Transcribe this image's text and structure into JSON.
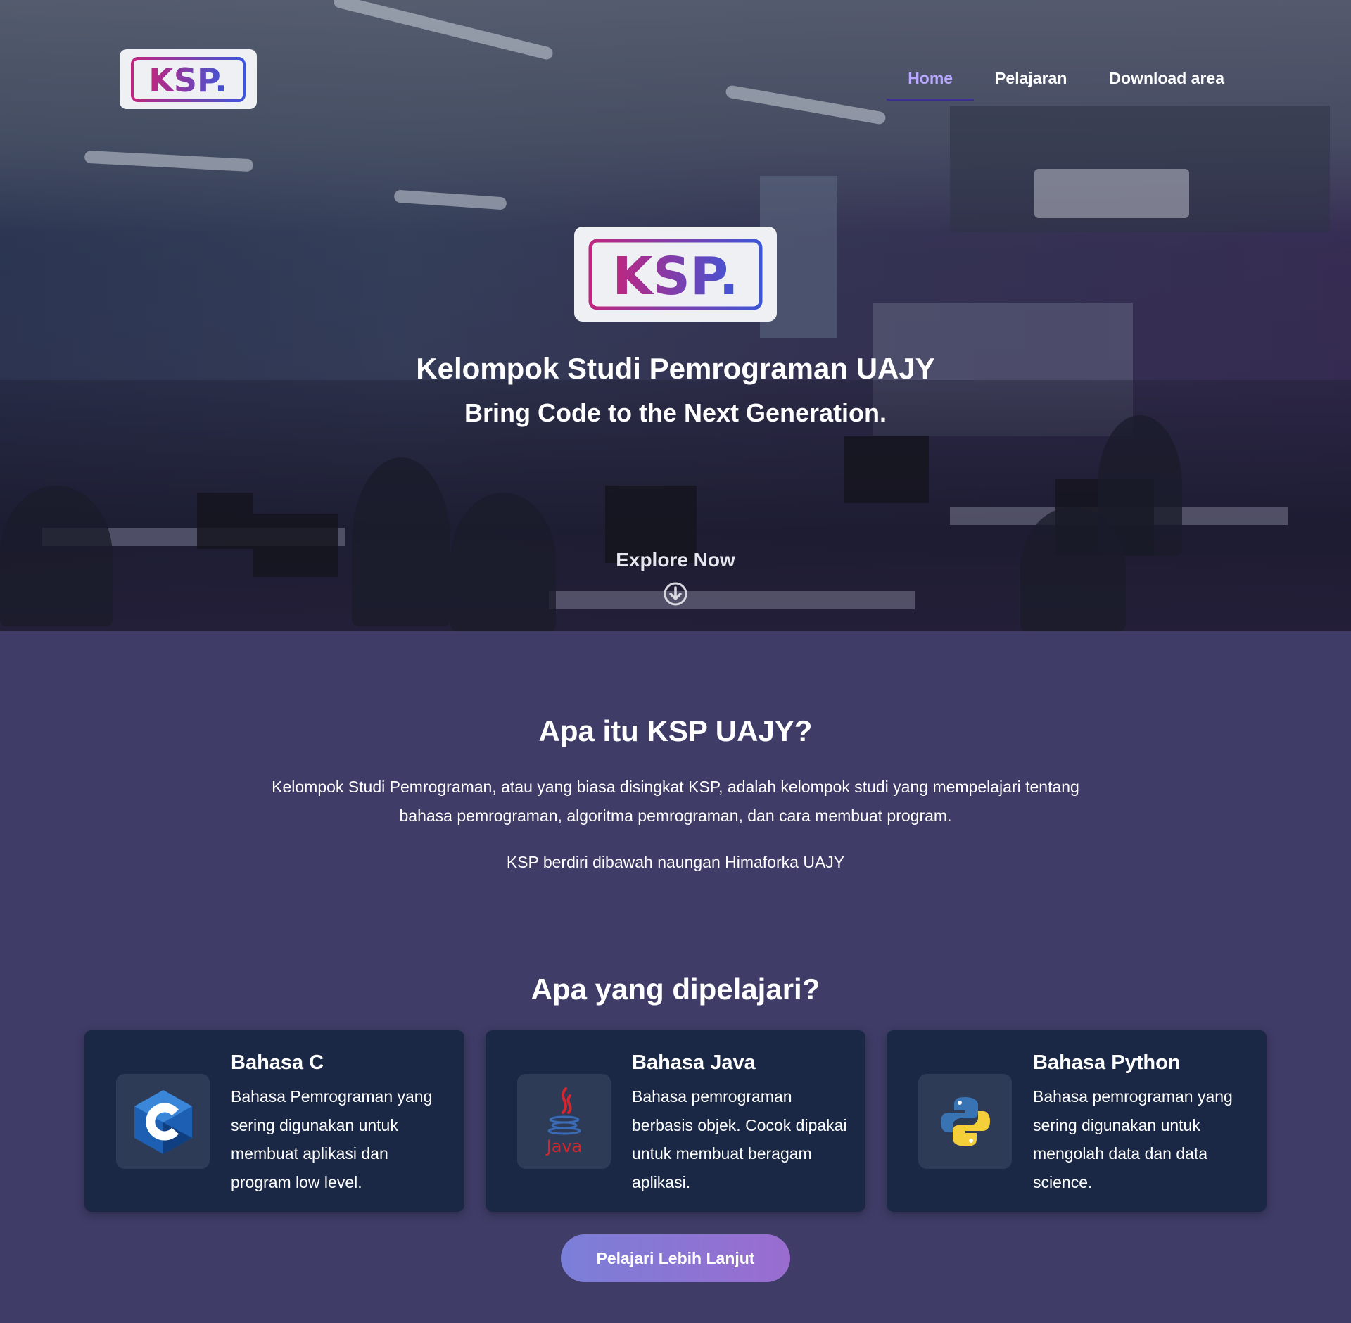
{
  "nav": {
    "logo_text": "KSP.",
    "items": [
      {
        "label": "Home",
        "active": true
      },
      {
        "label": "Pelajaran",
        "active": false
      },
      {
        "label": "Download area",
        "active": false
      }
    ]
  },
  "hero": {
    "logo_text": "KSP.",
    "title": "Kelompok Studi Pemrograman UAJY",
    "subtitle": "Bring Code to the Next Generation.",
    "explore_label": "Explore Now",
    "explore_icon": "arrow-down-circle-icon"
  },
  "about": {
    "title": "Apa itu KSP UAJY?",
    "description": "Kelompok Studi Pemrograman, atau yang biasa disingkat KSP, adalah kelompok studi yang mempelajari tentang bahasa pemrograman, algoritma pemrograman, dan cara membuat program.",
    "note": "KSP berdiri dibawah naungan Himaforka UAJY"
  },
  "learn": {
    "title": "Apa yang dipelajari?",
    "cards": [
      {
        "title": "Bahasa C",
        "desc": "Bahasa Pemrograman yang sering digunakan untuk membuat aplikasi dan program low level.",
        "icon": "c-language-icon"
      },
      {
        "title": "Bahasa Java",
        "desc": "Bahasa pemrograman berbasis objek. Cocok dipakai untuk membuat beragam aplikasi.",
        "icon": "java-icon",
        "icon_label": "Java"
      },
      {
        "title": "Bahasa Python",
        "desc": "Bahasa pemrograman yang sering digunakan untuk mengolah data dan data science.",
        "icon": "python-icon"
      }
    ],
    "cta_label": "Pelajari Lebih Lanjut"
  },
  "colors": {
    "page_bg": "#3f3d68",
    "card_bg": "#1a2845",
    "nav_active": "#b9a8ff",
    "logo_magenta": "#c0267f",
    "logo_blue": "#3d56d8"
  }
}
